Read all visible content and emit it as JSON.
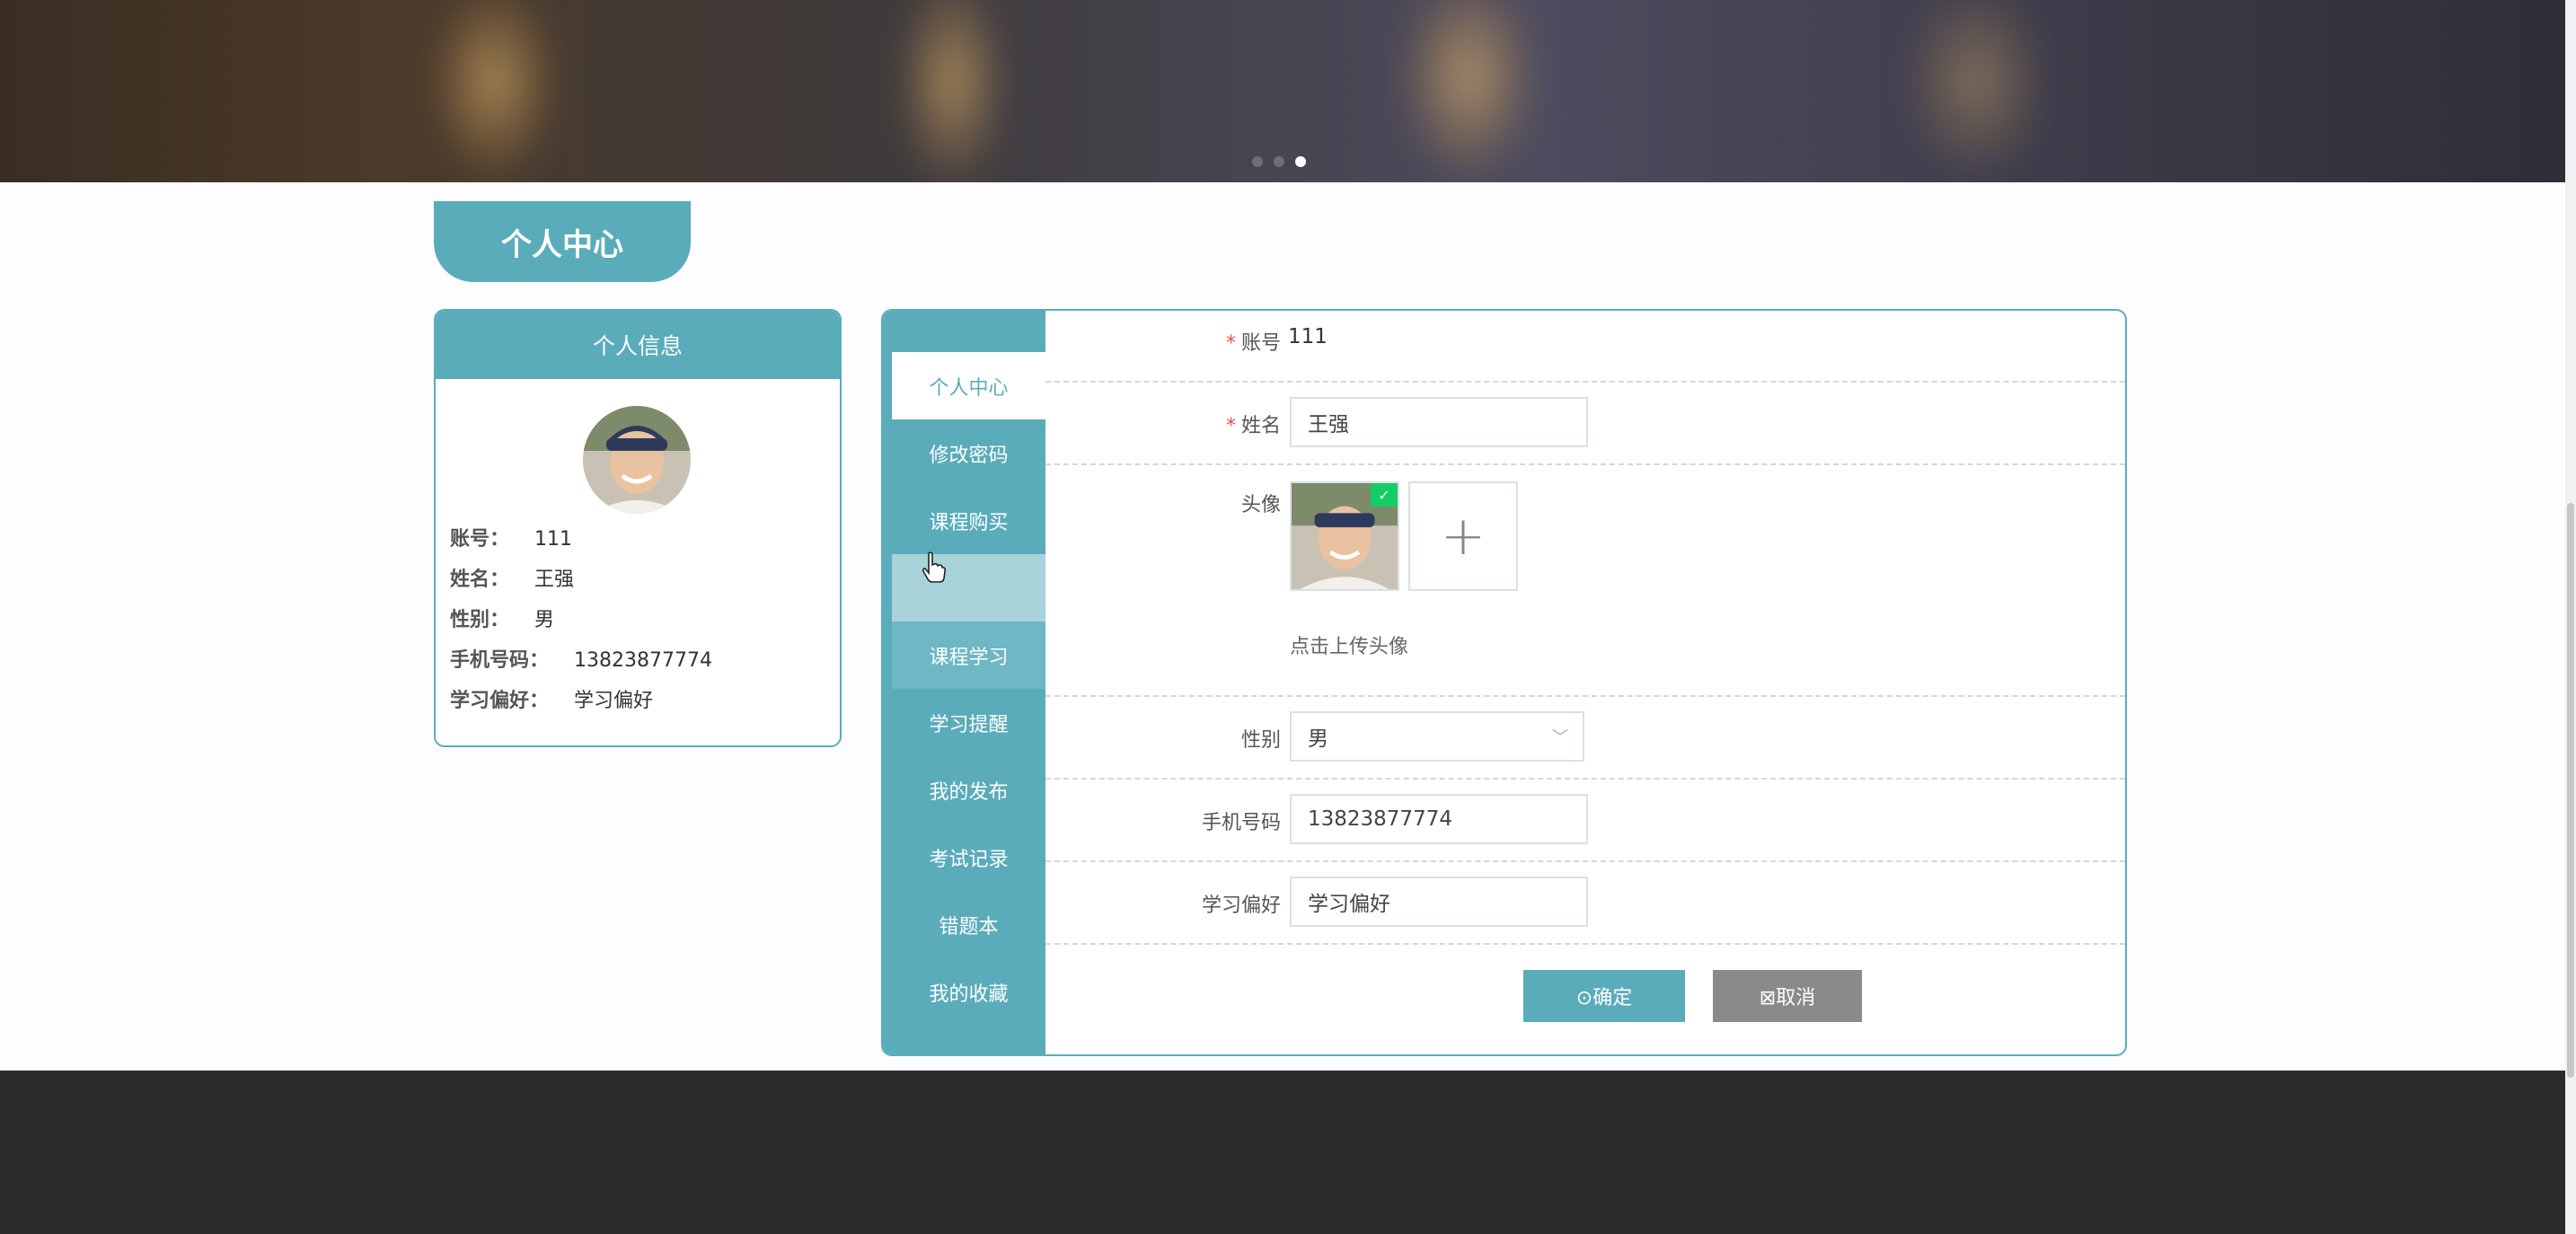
{
  "banner": {
    "dots": 3,
    "active_dot": 3
  },
  "page_title": "个人中心",
  "info_card": {
    "title": "个人信息",
    "rows": [
      {
        "k": "账号：",
        "v": "111"
      },
      {
        "k": "姓名：",
        "v": "王强"
      },
      {
        "k": "性别：",
        "v": "男"
      },
      {
        "k": "手机号码：",
        "v": "13823877774"
      },
      {
        "k": "学习偏好：",
        "v": "学习偏好"
      }
    ]
  },
  "side_nav": [
    {
      "label": "个人中心",
      "state": "active"
    },
    {
      "label": "修改密码",
      "state": "normal"
    },
    {
      "label": "课程购买",
      "state": "normal"
    },
    {
      "label": "",
      "state": "hover"
    },
    {
      "label": "课程学习",
      "state": "soft"
    },
    {
      "label": "学习提醒",
      "state": "normal"
    },
    {
      "label": "我的发布",
      "state": "normal"
    },
    {
      "label": "考试记录",
      "state": "normal"
    },
    {
      "label": "错题本",
      "state": "normal"
    },
    {
      "label": "我的收藏",
      "state": "normal"
    }
  ],
  "form": {
    "account_label": "账号",
    "account_value": "111",
    "name_label": "姓名",
    "name_value": "王强",
    "avatar_label": "头像",
    "upload_hint": "点击上传头像",
    "gender_label": "性别",
    "gender_value": "男",
    "phone_label": "手机号码",
    "phone_value": "13823877774",
    "pref_label": "学习偏好",
    "pref_value": "学习偏好",
    "required_mark": "*",
    "ok_label": "⊙确定",
    "cancel_label": "⊠取消"
  },
  "colors": {
    "accent": "#5aacbb",
    "footer": "#2b2a2c",
    "cancel": "#8a8a8a",
    "success": "#13ce66"
  }
}
